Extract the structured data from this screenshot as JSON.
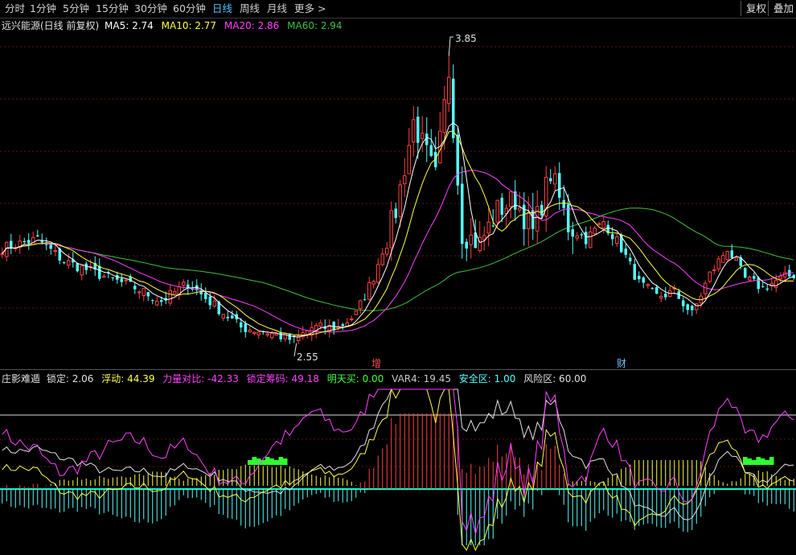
{
  "toolbar": {
    "tabs": [
      "分时",
      "1分钟",
      "5分钟",
      "15分钟",
      "30分钟",
      "60分钟",
      "日线",
      "周线",
      "月线",
      "更多 >"
    ],
    "active_tab": "日线",
    "right_buttons": [
      "复权",
      "叠加"
    ]
  },
  "main_legend": {
    "title": "远兴能源(日线 前复权)",
    "ma5": "MA5: 2.74",
    "ma10": "MA10: 2.77",
    "ma20": "MA20: 2.86",
    "ma60": "MA60: 2.94"
  },
  "annotations": {
    "high_label": "3.85",
    "low_label": "2.55",
    "marker_zeng": "增",
    "marker_cai": "财"
  },
  "indicator_legend": {
    "name": "庄影难遁",
    "suoding": "锁定: 2.06",
    "fudong": "浮动: 44.39",
    "liliang": "力量对比: -42.33",
    "choumu": "锁定筹码: 49.18",
    "mingtian": "明天买: 0.00",
    "var4": "VAR4: 19.45",
    "anquan": "安全区: 1.00",
    "fengxian": "风险区: 60.00"
  },
  "colors": {
    "up": "#ff4040",
    "down": "#54ffff",
    "ma5": "#ffffff",
    "ma10": "#ffff40",
    "ma20": "#ff40ff",
    "ma60": "#40c040",
    "active_tab": "#4fc3ff"
  },
  "chart_data": [
    {
      "type": "candlestick",
      "title": "远兴能源(日线 前复权)",
      "ylim": [
        2.45,
        3.95
      ],
      "period_count": 180,
      "price_path": [
        [
          0,
          2.98
        ],
        [
          8,
          3.02
        ],
        [
          14,
          2.92
        ],
        [
          22,
          2.86
        ],
        [
          30,
          2.8
        ],
        [
          36,
          2.74
        ],
        [
          42,
          2.82
        ],
        [
          48,
          2.72
        ],
        [
          54,
          2.62
        ],
        [
          60,
          2.6
        ],
        [
          66,
          2.56
        ],
        [
          70,
          2.62
        ],
        [
          76,
          2.62
        ],
        [
          80,
          2.68
        ],
        [
          84,
          2.85
        ],
        [
          89,
          3.15
        ],
        [
          93,
          3.55
        ],
        [
          98,
          3.3
        ],
        [
          101,
          3.78
        ],
        [
          104,
          3.05
        ],
        [
          108,
          3.0
        ],
        [
          112,
          3.15
        ],
        [
          116,
          3.2
        ],
        [
          120,
          3.05
        ],
        [
          124,
          3.32
        ],
        [
          128,
          3.08
        ],
        [
          132,
          3.02
        ],
        [
          136,
          3.1
        ],
        [
          140,
          2.98
        ],
        [
          144,
          2.82
        ],
        [
          148,
          2.76
        ],
        [
          152,
          2.78
        ],
        [
          156,
          2.68
        ],
        [
          160,
          2.86
        ],
        [
          164,
          2.98
        ],
        [
          168,
          2.84
        ],
        [
          172,
          2.8
        ],
        [
          176,
          2.84
        ],
        [
          179,
          2.86
        ]
      ],
      "high": 3.85,
      "low": 2.55,
      "series": [
        {
          "name": "MA5",
          "value": 2.74
        },
        {
          "name": "MA10",
          "value": 2.77
        },
        {
          "name": "MA20",
          "value": 2.86
        },
        {
          "name": "MA60",
          "value": 2.94
        }
      ]
    },
    {
      "type": "line",
      "title": "庄影难遁",
      "series": [
        {
          "name": "锁定",
          "value": 2.06
        },
        {
          "name": "浮动",
          "value": 44.39
        },
        {
          "name": "力量对比",
          "value": -42.33
        },
        {
          "name": "锁定筹码",
          "value": 49.18
        },
        {
          "name": "明天买",
          "value": 0.0
        },
        {
          "name": "VAR4",
          "value": 19.45
        },
        {
          "name": "安全区",
          "value": 1.0
        },
        {
          "name": "风险区",
          "value": 60.0
        }
      ]
    }
  ]
}
